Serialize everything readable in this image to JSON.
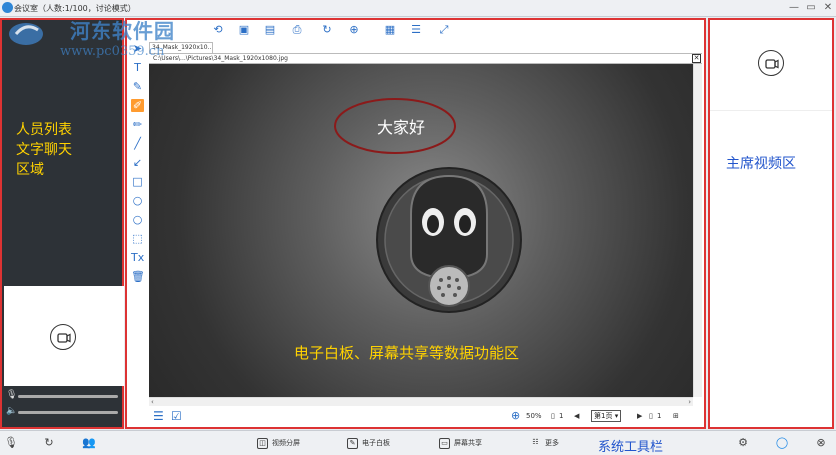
{
  "window": {
    "title": "会议室（人数:1/100，讨论模式）",
    "minimize": "—",
    "restore": "▭",
    "close": "✕"
  },
  "watermark": {
    "name": "河东软件园",
    "url": "www.pc0359.cn"
  },
  "left_panel": {
    "label_lines": [
      "人员列表",
      "文字聊天",
      "区域"
    ],
    "camera_icon": "video-camera-icon",
    "audio": {
      "mic_icon": "microphone-icon",
      "speaker_icon": "speaker-icon"
    }
  },
  "center_panel": {
    "file_tab": "34_Mask_1920x10...",
    "file_path": "C:\\Users\\...\\Pictures\\34_Mask_1920x1080.jpg",
    "canvas": {
      "greeting": "大家好",
      "label": "电子白板、屏幕共享等数据功能区"
    },
    "status": {
      "zoom": "50%",
      "page_count_left": "1",
      "page_select": "第1页",
      "page_count_right": "1"
    }
  },
  "right_panel": {
    "label": "主席视频区",
    "camera_icon": "video-camera-icon"
  },
  "bottom_bar": {
    "buttons": [
      {
        "label": "视频分屏",
        "icon": "split-screen-icon"
      },
      {
        "label": "电子白板",
        "icon": "whiteboard-icon"
      },
      {
        "label": "屏幕共享",
        "icon": "screen-share-icon"
      },
      {
        "label": "更多",
        "icon": "more-icon"
      }
    ],
    "system_label": "系统工具栏"
  },
  "colors": {
    "region_border": "#dd3333",
    "label_yellow": "#ffd200",
    "label_blue": "#2255cc",
    "accent": "#2c6fc6"
  }
}
